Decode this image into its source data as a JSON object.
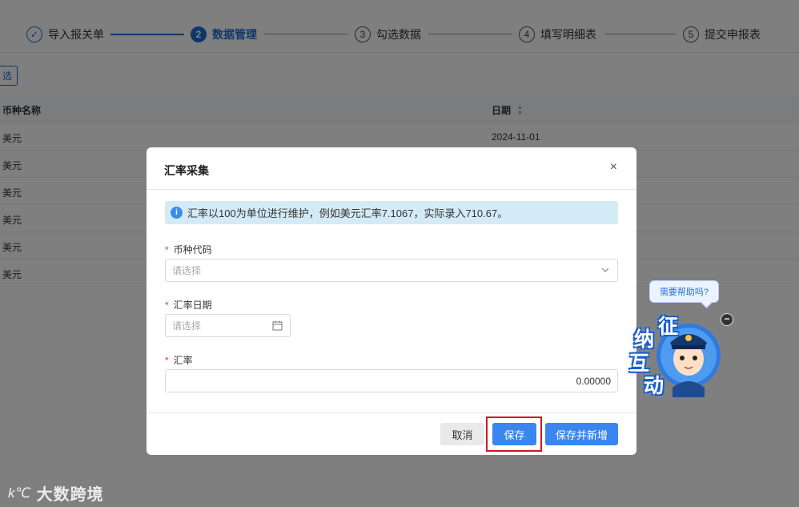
{
  "steps": [
    {
      "num": "✓",
      "label": "导入报关单"
    },
    {
      "num": "2",
      "label": "数据管理"
    },
    {
      "num": "3",
      "label": "勾选数据"
    },
    {
      "num": "4",
      "label": "填写明细表"
    },
    {
      "num": "5",
      "label": "提交申报表"
    }
  ],
  "toolbar": {
    "filter_label": "选"
  },
  "table": {
    "headers": [
      "币种名称",
      "日期"
    ],
    "rows": [
      {
        "currency": "美元",
        "date": "2024-11-01"
      },
      {
        "currency": "美元",
        "date": ""
      },
      {
        "currency": "美元",
        "date": ""
      },
      {
        "currency": "美元",
        "date": ""
      },
      {
        "currency": "美元",
        "date": ""
      },
      {
        "currency": "美元",
        "date": ""
      }
    ]
  },
  "modal": {
    "title": "汇率采集",
    "close": "×",
    "alert_text": "汇率以100为单位进行维护，例如美元汇率7.1067，实际录入710.67。",
    "fields": {
      "currency_code": {
        "label": "币种代码",
        "placeholder": "请选择"
      },
      "rate_date": {
        "label": "汇率日期",
        "placeholder": "请选择"
      },
      "rate": {
        "label": "汇率",
        "value": "0.00000"
      }
    },
    "buttons": {
      "cancel": "取消",
      "save": "保存",
      "save_new": "保存并新增"
    }
  },
  "help": {
    "bubble": "需要帮助吗?",
    "close": "−",
    "chars": [
      "征",
      "纳",
      "互",
      "动"
    ]
  },
  "watermark": {
    "logo": "大数跨境"
  },
  "colors": {
    "primary": "#3a86f0",
    "highlight": "#d0181d",
    "alert_bg": "#d4ebf7"
  }
}
